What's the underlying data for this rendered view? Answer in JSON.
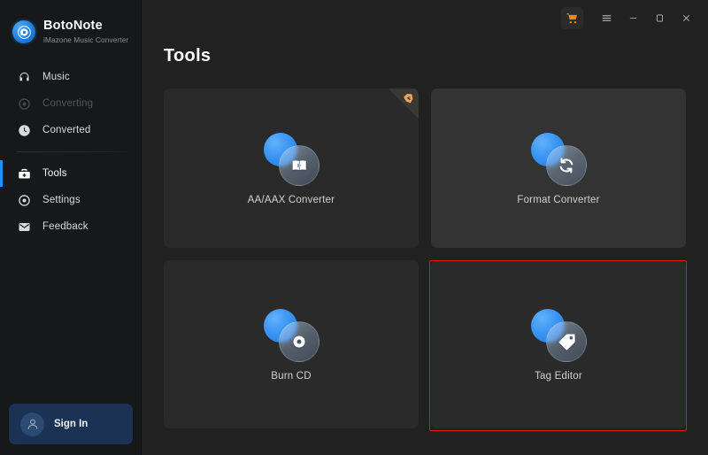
{
  "app": {
    "brand_title": "BotoNote",
    "brand_subtitle": "iMazone Music Converter",
    "logo_icon": "botonote-logo-icon"
  },
  "titlebar": {
    "cart_icon": "shopping-cart-icon",
    "menu_icon": "hamburger-menu-icon",
    "minimize_icon": "minimize-icon",
    "maximize_icon": "maximize-icon",
    "close_icon": "close-icon"
  },
  "sidebar": {
    "items": [
      {
        "label": "Music",
        "icon": "headphones-icon",
        "state": "normal"
      },
      {
        "label": "Converting",
        "icon": "converting-icon",
        "state": "disabled"
      },
      {
        "label": "Converted",
        "icon": "clock-icon",
        "state": "normal"
      },
      {
        "label": "Tools",
        "icon": "toolbox-icon",
        "state": "active"
      },
      {
        "label": "Settings",
        "icon": "gear-icon",
        "state": "normal"
      },
      {
        "label": "Feedback",
        "icon": "envelope-icon",
        "state": "normal"
      }
    ],
    "signin": {
      "label": "Sign In",
      "avatar_icon": "user-avatar-icon"
    }
  },
  "main": {
    "page_title": "Tools",
    "cards": [
      {
        "label": "AA/AAX Converter",
        "icon": "play-book-icon",
        "badge": "premium-ribbon-badge",
        "state": "normal"
      },
      {
        "label": "Format Converter",
        "icon": "refresh-sync-icon",
        "badge": null,
        "state": "hover"
      },
      {
        "label": "Burn CD",
        "icon": "cd-disc-icon",
        "badge": null,
        "state": "normal"
      },
      {
        "label": "Tag Editor",
        "icon": "price-tag-icon",
        "badge": null,
        "state": "highlighted"
      }
    ]
  },
  "annotation": {
    "type": "red-rectangle-highlight",
    "target": "Tag Editor",
    "color": "#f31212"
  },
  "colors": {
    "sidebar_bg": "#16181a",
    "main_bg": "#212121",
    "card_bg": "#2a2a2a",
    "card_hover_bg": "#333333",
    "accent_blue": "#1e90ff",
    "icon_blue": "#3a94f2",
    "cart_orange": "#e8881f",
    "signin_bg": "#1b3254",
    "annotation_red": "#f31212"
  }
}
